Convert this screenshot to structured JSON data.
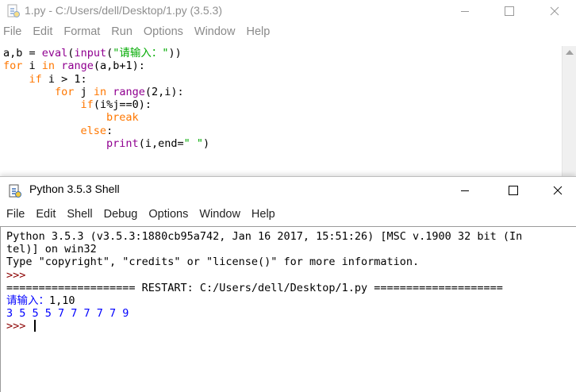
{
  "editor": {
    "title": "1.py - C:/Users/dell/Desktop/1.py (3.5.3)",
    "menu": [
      "File",
      "Edit",
      "Format",
      "Run",
      "Options",
      "Window",
      "Help"
    ],
    "code_lines": [
      [
        {
          "t": "a,b = "
        },
        {
          "t": "eval",
          "c": "bi"
        },
        {
          "t": "("
        },
        {
          "t": "input",
          "c": "bi"
        },
        {
          "t": "("
        },
        {
          "t": "\"请输入：\"",
          "c": "str"
        },
        {
          "t": "))"
        }
      ],
      [
        {
          "t": "for",
          "c": "kw"
        },
        {
          "t": " i "
        },
        {
          "t": "in",
          "c": "kw"
        },
        {
          "t": " "
        },
        {
          "t": "range",
          "c": "bi"
        },
        {
          "t": "(a,b+1):"
        }
      ],
      [
        {
          "t": "    "
        },
        {
          "t": "if",
          "c": "kw"
        },
        {
          "t": " i > 1:"
        }
      ],
      [
        {
          "t": "        "
        },
        {
          "t": "for",
          "c": "kw"
        },
        {
          "t": " j "
        },
        {
          "t": "in",
          "c": "kw"
        },
        {
          "t": " "
        },
        {
          "t": "range",
          "c": "bi"
        },
        {
          "t": "(2,i):"
        }
      ],
      [
        {
          "t": "            "
        },
        {
          "t": "if",
          "c": "kw"
        },
        {
          "t": "(i%j==0):"
        }
      ],
      [
        {
          "t": "                "
        },
        {
          "t": "break",
          "c": "kw"
        }
      ],
      [
        {
          "t": "            "
        },
        {
          "t": "else",
          "c": "kw"
        },
        {
          "t": ":"
        }
      ],
      [
        {
          "t": "                "
        },
        {
          "t": "print",
          "c": "bi"
        },
        {
          "t": "(i,end="
        },
        {
          "t": "\" \"",
          "c": "str"
        },
        {
          "t": ")"
        }
      ]
    ]
  },
  "shell": {
    "title": "Python 3.5.3 Shell",
    "menu": [
      "File",
      "Edit",
      "Shell",
      "Debug",
      "Options",
      "Window",
      "Help"
    ],
    "lines": [
      {
        "t": "Python 3.5.3 (v3.5.3:1880cb95a742, Jan 16 2017, 15:51:26) [MSC v.1900 32 bit (In"
      },
      {
        "t": "tel)] on win32"
      },
      {
        "t": "Type \"copyright\", \"credits\" or \"license()\" for more information."
      },
      {
        "t": ">>> ",
        "c": "prompt"
      },
      {
        "t": "==================== RESTART: C:/Users/dell/Desktop/1.py ===================="
      },
      {
        "t": "请输入：",
        "c": "blue",
        "rest": "1,10"
      },
      {
        "t": "3 5 5 5 7 7 7 7 7 9",
        "c": "blue"
      },
      {
        "t": ">>> ",
        "c": "prompt",
        "cursor": true
      }
    ]
  },
  "colors": {
    "keyword": "#ff7700",
    "builtin": "#900090",
    "string": "#00aa00",
    "output": "#0000ff",
    "prompt": "#8b0000"
  }
}
